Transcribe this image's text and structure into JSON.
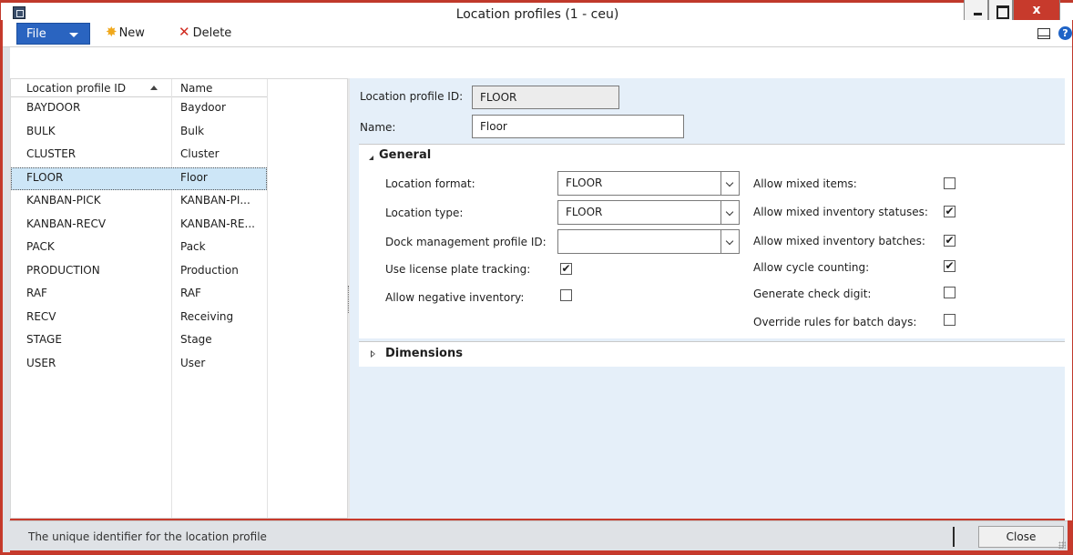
{
  "window": {
    "title": "Location profiles (1 - ceu)",
    "close_glyph": "x",
    "colors": {
      "titlebar_border": "#c0392b",
      "accent": "#2a64c0",
      "selection": "#cde6f7",
      "detail_bg": "#e5eff9"
    }
  },
  "toolbar": {
    "file_label": "File",
    "new_label": "New",
    "delete_label": "Delete",
    "help_glyph": "?",
    "icons": [
      "new-star-icon",
      "delete-x-icon",
      "book-icon",
      "help-icon"
    ]
  },
  "list": {
    "columns": [
      "Location profile ID",
      "Name"
    ],
    "sort": "ascending",
    "selected_index": 3,
    "rows": [
      {
        "id": "BAYDOOR",
        "name": "Baydoor"
      },
      {
        "id": "BULK",
        "name": "Bulk"
      },
      {
        "id": "CLUSTER",
        "name": "Cluster"
      },
      {
        "id": "FLOOR",
        "name": "Floor"
      },
      {
        "id": "KANBAN-PICK",
        "name": "KANBAN-PI..."
      },
      {
        "id": "KANBAN-RECV",
        "name": "KANBAN-RE..."
      },
      {
        "id": "PACK",
        "name": "Pack"
      },
      {
        "id": "PRODUCTION",
        "name": "Production"
      },
      {
        "id": "RAF",
        "name": "RAF"
      },
      {
        "id": "RECV",
        "name": "Receiving"
      },
      {
        "id": "STAGE",
        "name": "Stage"
      },
      {
        "id": "USER",
        "name": "User"
      }
    ]
  },
  "detail": {
    "profile_id_label": "Location profile ID:",
    "profile_id_value": "FLOOR",
    "name_label": "Name:",
    "name_value": "Floor",
    "general": {
      "title": "General",
      "location_format_label": "Location format:",
      "location_format_value": "FLOOR",
      "location_type_label": "Location type:",
      "location_type_value": "FLOOR",
      "dock_profile_label": "Dock management profile ID:",
      "dock_profile_value": "",
      "use_lp_label": "Use license plate tracking:",
      "use_lp_checked": true,
      "allow_negative_label": "Allow negative inventory:",
      "allow_negative_checked": false,
      "allow_mixed_items_label": "Allow mixed items:",
      "allow_mixed_items_checked": false,
      "allow_mixed_statuses_label": "Allow mixed  inventory statuses:",
      "allow_mixed_statuses_checked": true,
      "allow_mixed_batches_label": "Allow mixed inventory batches:",
      "allow_mixed_batches_checked": true,
      "allow_cycle_label": "Allow cycle counting:",
      "allow_cycle_checked": true,
      "gen_check_label": "Generate check digit:",
      "gen_check_checked": false,
      "override_label": "Override rules for batch days:",
      "override_checked": false
    },
    "dimensions": {
      "title": "Dimensions"
    }
  },
  "status": {
    "text": "The unique identifier for the location profile",
    "close_label": "Close"
  }
}
